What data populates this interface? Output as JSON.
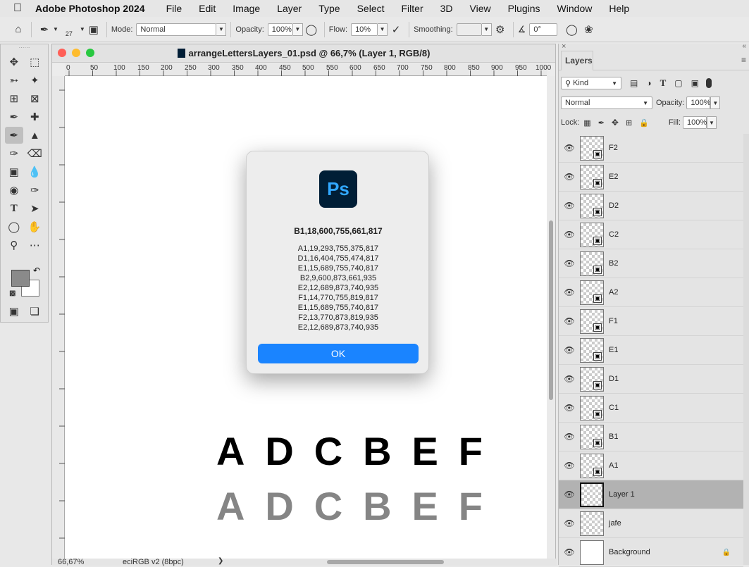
{
  "menubar": {
    "app": "Adobe Photoshop 2024",
    "items": [
      "File",
      "Edit",
      "Image",
      "Layer",
      "Type",
      "Select",
      "Filter",
      "3D",
      "View",
      "Plugins",
      "Window",
      "Help"
    ]
  },
  "options": {
    "brush_size": "27",
    "mode_label": "Mode:",
    "mode_value": "Normal",
    "opacity_label": "Opacity:",
    "opacity_value": "100%",
    "flow_label": "Flow:",
    "flow_value": "10%",
    "smoothing_label": "Smoothing:",
    "angle_value": "0°"
  },
  "document": {
    "title": "arrangeLettersLayers_01.psd @ 66,7% (Layer 1, RGB/8)",
    "zoom": "66,67%",
    "profile": "eciRGB v2 (8bpc)",
    "ruler_ticks": [
      "0",
      "50",
      "100",
      "150",
      "200",
      "250",
      "300",
      "350",
      "400",
      "450",
      "500",
      "550",
      "600",
      "650",
      "700",
      "750",
      "800",
      "850",
      "900",
      "950",
      "1000"
    ],
    "letters_top": [
      "A",
      "D",
      "C",
      "B",
      "E",
      "F"
    ],
    "letters_bottom": [
      "A",
      "D",
      "C",
      "B",
      "E",
      "F"
    ]
  },
  "dialog": {
    "icon_text": "Ps",
    "headline": "B1,18,600,755,661,817",
    "lines": [
      "A1,19,293,755,375,817",
      "D1,16,404,755,474,817",
      "E1,15,689,755,740,817",
      "B2,9,600,873,661,935",
      "E2,12,689,873,740,935",
      "F1,14,770,755,819,817",
      "E1,15,689,755,740,817",
      "F2,13,770,873,819,935",
      "E2,12,689,873,740,935"
    ],
    "ok_label": "OK"
  },
  "layers_panel": {
    "tab_label": "Layers",
    "kind_label": "Kind",
    "blend_mode": "Normal",
    "opacity_label": "Opacity:",
    "opacity_value": "100%",
    "lock_label": "Lock:",
    "fill_label": "Fill:",
    "fill_value": "100%",
    "layers": [
      {
        "name": "F2"
      },
      {
        "name": "E2"
      },
      {
        "name": "D2"
      },
      {
        "name": "C2"
      },
      {
        "name": "B2"
      },
      {
        "name": "A2"
      },
      {
        "name": "F1"
      },
      {
        "name": "E1"
      },
      {
        "name": "D1"
      },
      {
        "name": "C1"
      },
      {
        "name": "B1"
      },
      {
        "name": "A1"
      },
      {
        "name": "Layer 1"
      },
      {
        "name": "jafe"
      },
      {
        "name": "Background"
      }
    ]
  }
}
